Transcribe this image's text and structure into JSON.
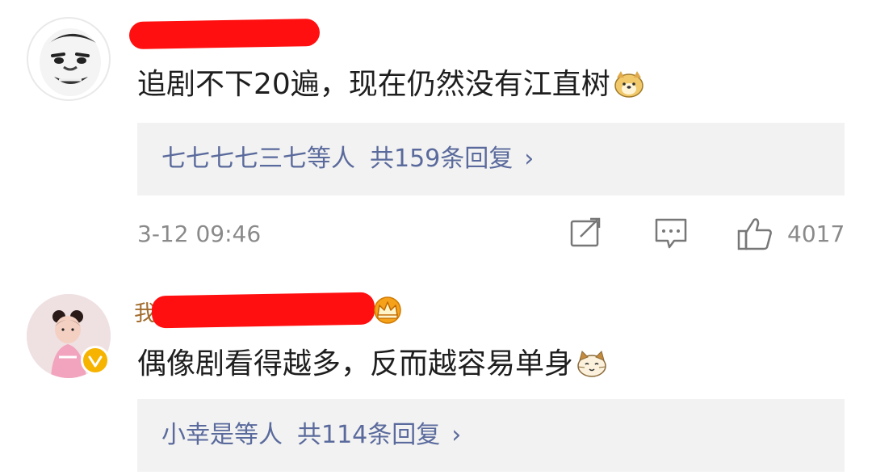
{
  "comments": [
    {
      "text": "追剧不下20遍，现在仍然没有江直树",
      "name_fragment": "",
      "reply_users": "七七七七三七等人",
      "reply_count": "共159条回复",
      "reply_chevron": "›",
      "time": "3-12 09:46",
      "likes": "4017",
      "emoji": "dog-face-icon"
    },
    {
      "text": "偶像剧看得越多，反而越容易单身",
      "name_fragment": "我",
      "reply_users": "小幸是等人",
      "reply_count": "共114条回复",
      "reply_chevron": "›",
      "emoji": "cat-face-icon",
      "badge": "crown-icon"
    }
  ],
  "colors": {
    "redaction": "#ff0f0f",
    "link": "#5a6a9c",
    "meta": "#8a8a8a",
    "reply_bg": "#f2f2f2"
  }
}
